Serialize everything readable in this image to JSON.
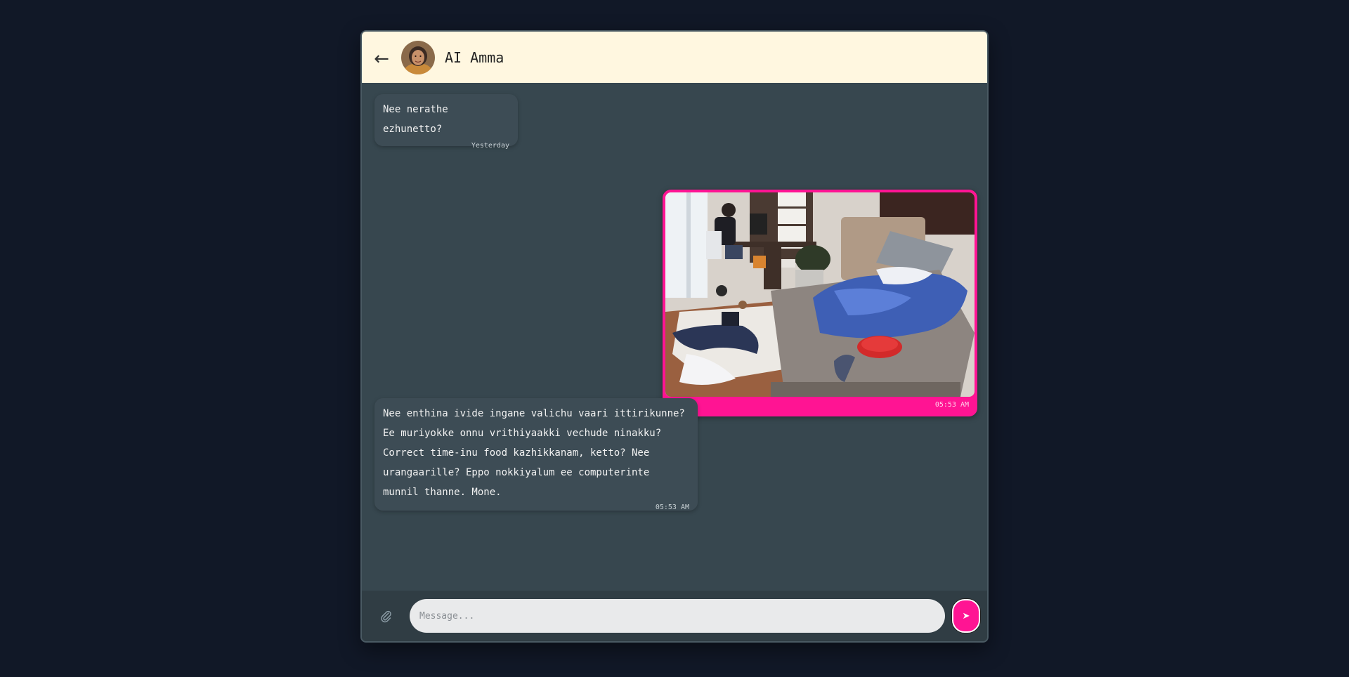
{
  "header": {
    "back_icon": "←",
    "contact_name": "AI Amma"
  },
  "messages": [
    {
      "sender": "contact",
      "text": "Nee nerathe ezhunetto?",
      "time": "Yesterday"
    },
    {
      "sender": "user",
      "type": "image",
      "image_description": "messy bedroom with person at computer desk",
      "time": "05:53 AM"
    },
    {
      "sender": "contact",
      "text": "Nee enthina ivide ingane valichu vaari ittirikunne? Ee muriyokke onnu vrithiyaakki vechude ninakku? Correct time-inu food kazhikkanam, ketto? Nee urangaarille? Eppo nokkiyalum ee computerinte munnil thanne. Mone.",
      "time": "05:53 AM"
    }
  ],
  "composer": {
    "placeholder": "Message...",
    "send_icon": "➤",
    "attach_icon": "paperclip-icon"
  },
  "colors": {
    "accent": "#ff1493",
    "header_bg": "#fff7e0",
    "chat_bg": "#37474f",
    "page_bg": "#111827"
  }
}
